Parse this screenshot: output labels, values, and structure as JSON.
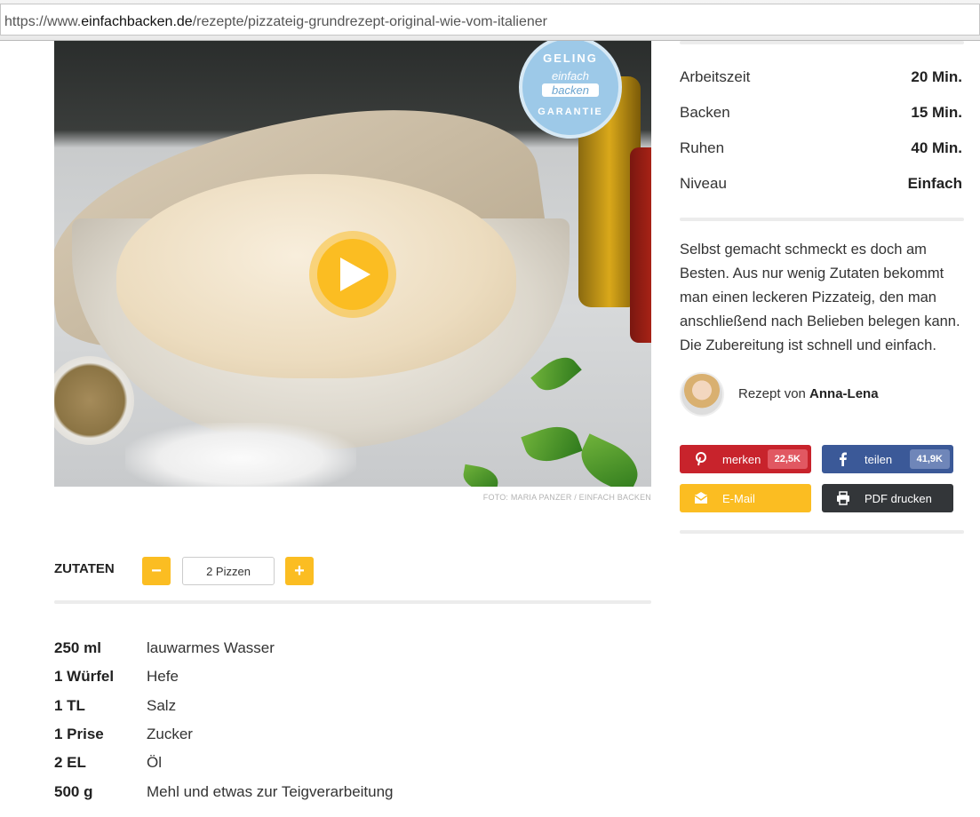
{
  "browser": {
    "url_prefix": "https://www.",
    "url_domain": "einfachbacken.de",
    "url_path": "/rezepte/pizzateig-grundrezept-original-wie-vom-italiener"
  },
  "hero": {
    "badge": {
      "line1": "GELING",
      "line2": "einfach",
      "line3": "backen",
      "line4": "GARANTIE"
    },
    "credit": "FOTO: MARIA PANZER / EINFACH BACKEN",
    "play_icon": "play-icon"
  },
  "ingredients": {
    "title": "ZUTATEN",
    "minus": "−",
    "plus": "+",
    "servings": "2 Pizzen",
    "items": [
      {
        "amount": "250 ml",
        "name": "lauwarmes Wasser"
      },
      {
        "amount": "1 Würfel",
        "name": "Hefe"
      },
      {
        "amount": "1 TL",
        "name": "Salz"
      },
      {
        "amount": "1 Prise",
        "name": "Zucker"
      },
      {
        "amount": "2 EL",
        "name": "Öl"
      },
      {
        "amount": "500 g",
        "name": "Mehl und etwas zur Teigverarbeitung"
      }
    ]
  },
  "meta": [
    {
      "label": "Arbeitszeit",
      "value": "20 Min."
    },
    {
      "label": "Backen",
      "value": "15 Min."
    },
    {
      "label": "Ruhen",
      "value": "40 Min."
    },
    {
      "label": "Niveau",
      "value": "Einfach"
    }
  ],
  "description": "Selbst gemacht schmeckt es doch am Besten. Aus nur wenig Zutaten bekommt man einen leckeren Pizzateig, den man anschließend nach Belieben belegen kann. Die Zubereitung ist schnell und einfach.",
  "author": {
    "prefix": "Rezept von ",
    "name": "Anna-Lena"
  },
  "share": {
    "pinterest": {
      "label": "merken",
      "count": "22,5K",
      "icon": "pinterest-icon"
    },
    "facebook": {
      "label": "teilen",
      "count": "41,9K",
      "icon": "facebook-icon"
    },
    "email": {
      "label": "E-Mail",
      "icon": "mail-icon"
    },
    "pdf": {
      "label": "PDF drucken",
      "icon": "printer-icon"
    }
  },
  "colors": {
    "accent": "#fbbd22",
    "pinterest": "#c8232c",
    "facebook": "#3b5998",
    "dark": "#333639"
  }
}
